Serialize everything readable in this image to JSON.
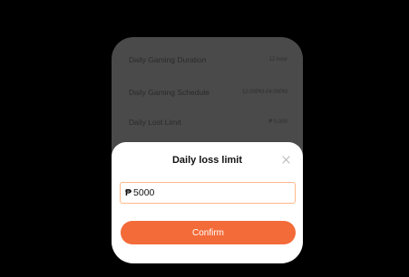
{
  "settings": {
    "rows": [
      {
        "label": "Daily Gaming Duration",
        "value": "12 hour"
      },
      {
        "label": "Daily Gaming Schedule",
        "value": "12:00PM-04:00PM"
      },
      {
        "label": "Daily Lost Limit",
        "value": "₱ 5,000"
      }
    ]
  },
  "dialog": {
    "title": "Daily loss limit",
    "close_icon": "close-icon",
    "currency_symbol": "₱",
    "amount_value": "5000",
    "confirm_label": "Confirm"
  },
  "colors": {
    "accent": "#f36b38",
    "input_border": "#ffb88a",
    "backdrop": "#000000",
    "dimmed_card": "#4a4a4a"
  }
}
